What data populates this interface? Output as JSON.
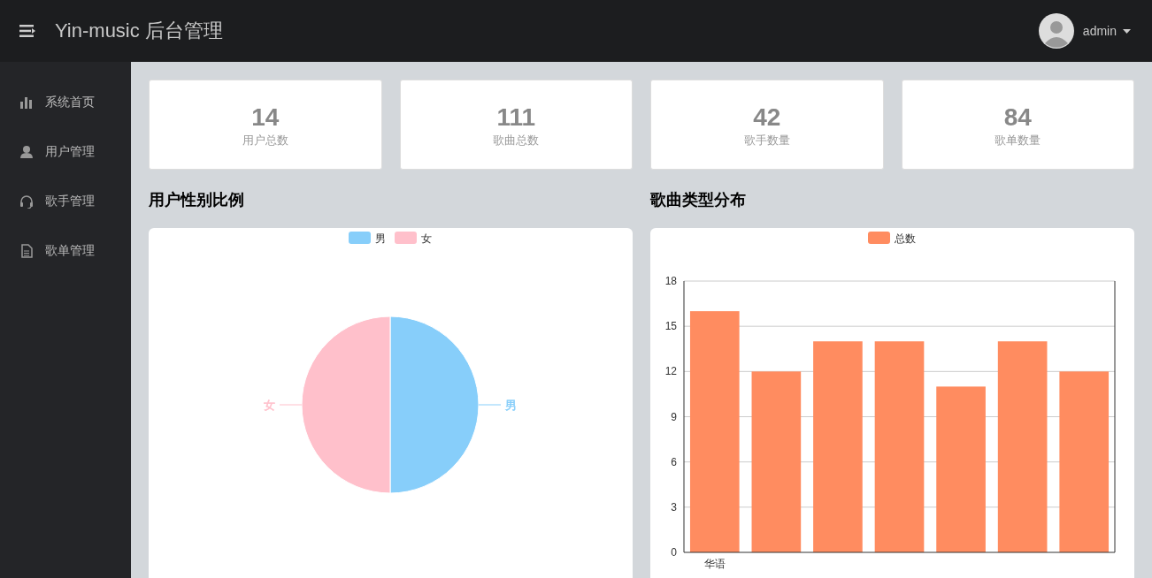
{
  "header": {
    "title": "Yin-music 后台管理",
    "user": "admin"
  },
  "sidebar": {
    "items": [
      {
        "label": "系统首页",
        "kind": "bars",
        "selected": false
      },
      {
        "label": "用户管理",
        "kind": "user",
        "selected": false
      },
      {
        "label": "歌手管理",
        "kind": "headset",
        "selected": false
      },
      {
        "label": "歌单管理",
        "kind": "doc",
        "selected": false
      }
    ]
  },
  "stats": [
    {
      "value": "14",
      "label": "用户总数"
    },
    {
      "value": "111",
      "label": "歌曲总数"
    },
    {
      "value": "42",
      "label": "歌手数量"
    },
    {
      "value": "84",
      "label": "歌单数量"
    }
  ],
  "gender_panel": {
    "title": "用户性别比例",
    "slices": [
      {
        "name": "男",
        "color": "#87cefa"
      },
      {
        "name": "女",
        "color": "#ffc0cb"
      }
    ],
    "slice_labels": [
      {
        "text": "女",
        "kind": "left",
        "color": "#ffc0cb"
      },
      {
        "text": "男",
        "kind": "right",
        "color": "#87cefa"
      }
    ]
  },
  "genre_panel": {
    "title": "歌曲类型分布",
    "chart_data": {
      "type": "bar",
      "categories": [
        "华语",
        null,
        null,
        null,
        null,
        null,
        null
      ],
      "series": [
        {
          "name": "总数",
          "color": "#ff8c60",
          "values": [
            16,
            12,
            14,
            14,
            11,
            14,
            12
          ]
        }
      ],
      "ylim": [
        0,
        18
      ],
      "grid": true,
      "yticks": [
        0,
        3,
        6,
        9,
        12,
        15,
        18
      ]
    }
  }
}
